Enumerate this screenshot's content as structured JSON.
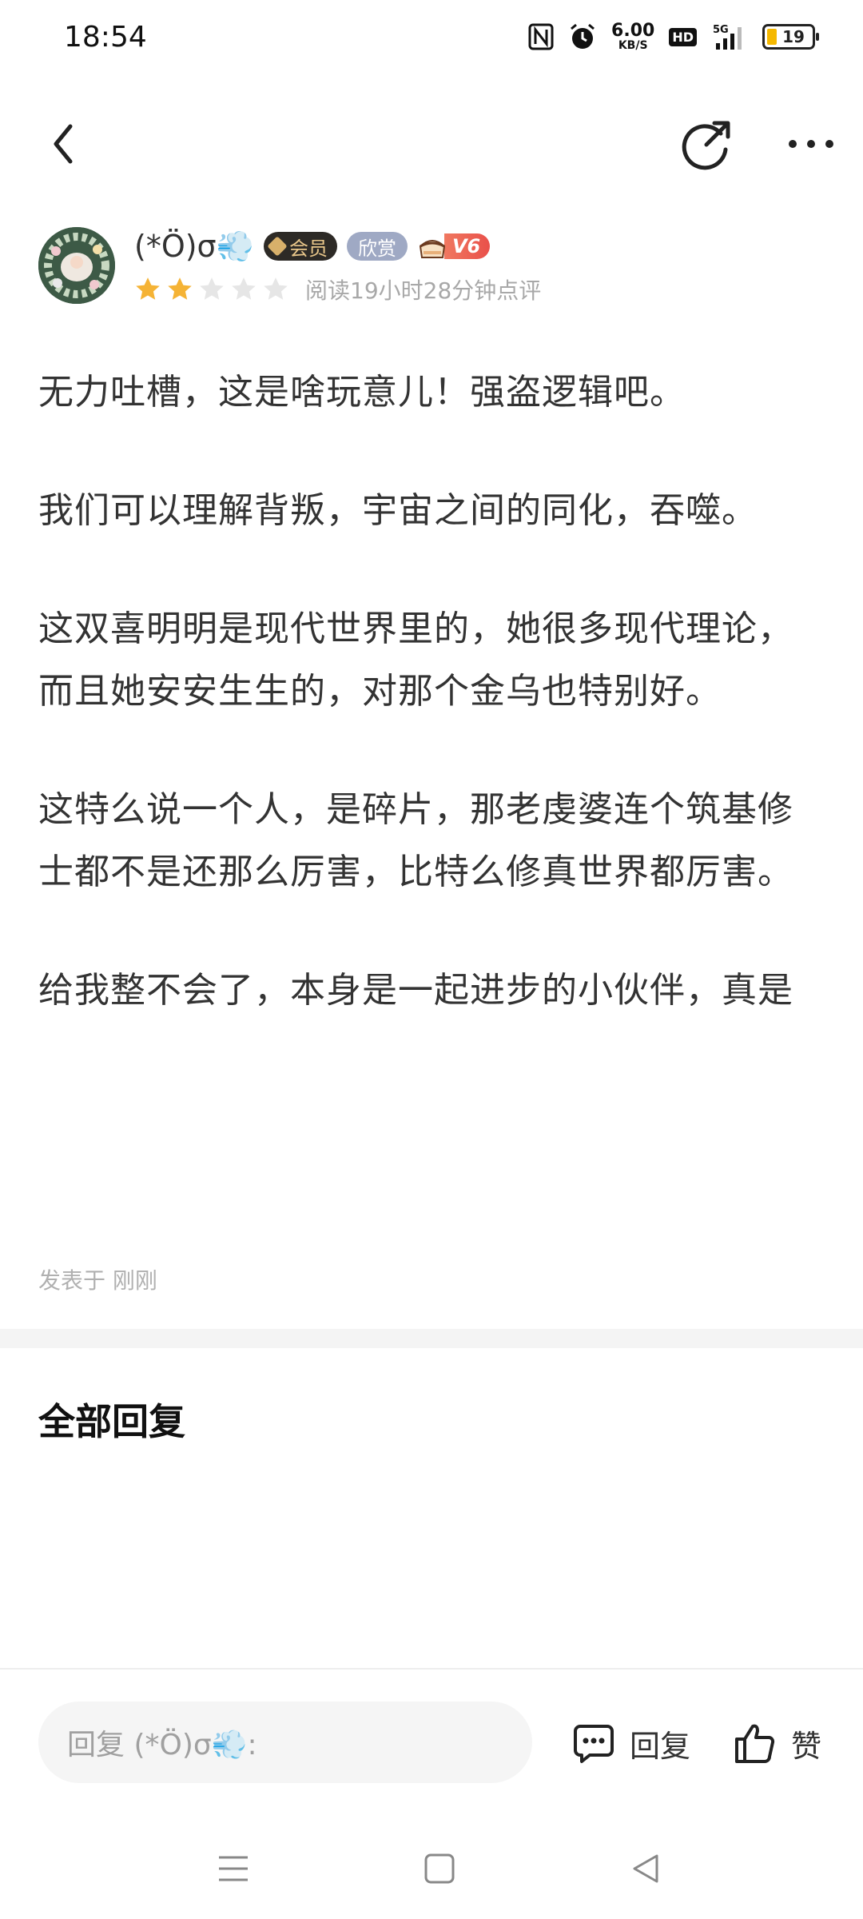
{
  "status_bar": {
    "time": "18:54",
    "net_speed_value": "6.00",
    "net_speed_unit": "KB/S",
    "hd_label": "HD",
    "signal_label": "5G",
    "battery_level": "19",
    "icons": [
      "nfc-icon",
      "alarm-icon",
      "hd-icon",
      "signal-icon",
      "battery-icon"
    ]
  },
  "nav": {
    "icons": [
      "back-icon",
      "share-icon",
      "more-icon"
    ]
  },
  "author": {
    "name": "(*Ö)σ💨",
    "badge_vip": "会员",
    "badge_like": "欣赏",
    "badge_level": "V6",
    "rating": 2,
    "rating_max": 5,
    "read_time": "阅读19小时28分钟点评"
  },
  "content": {
    "paragraphs": [
      "无力吐槽，这是啥玩意儿！强盗逻辑吧。",
      "我们可以理解背叛，宇宙之间的同化，吞噬。",
      "这双喜明明是现代世界里的，她很多现代理论，而且她安安生生的，对那个金乌也特别好。",
      "这特么说一个人，是碎片，那老虔婆连个筑基修士都不是还那么厉害，比特么修真世界都厉害。",
      "给我整不会了，本身是一起进步的小伙伴，真是"
    ],
    "post_time": "发表于 刚刚"
  },
  "replies": {
    "title": "全部回复"
  },
  "reply_bar": {
    "placeholder": "回复 (*Ö)σ💨:",
    "reply_label": "回复",
    "like_label": "赞"
  },
  "colors": {
    "star_active": "#f5b335",
    "star_inactive": "#e6e6e6",
    "divider": "#f4f4f4"
  }
}
